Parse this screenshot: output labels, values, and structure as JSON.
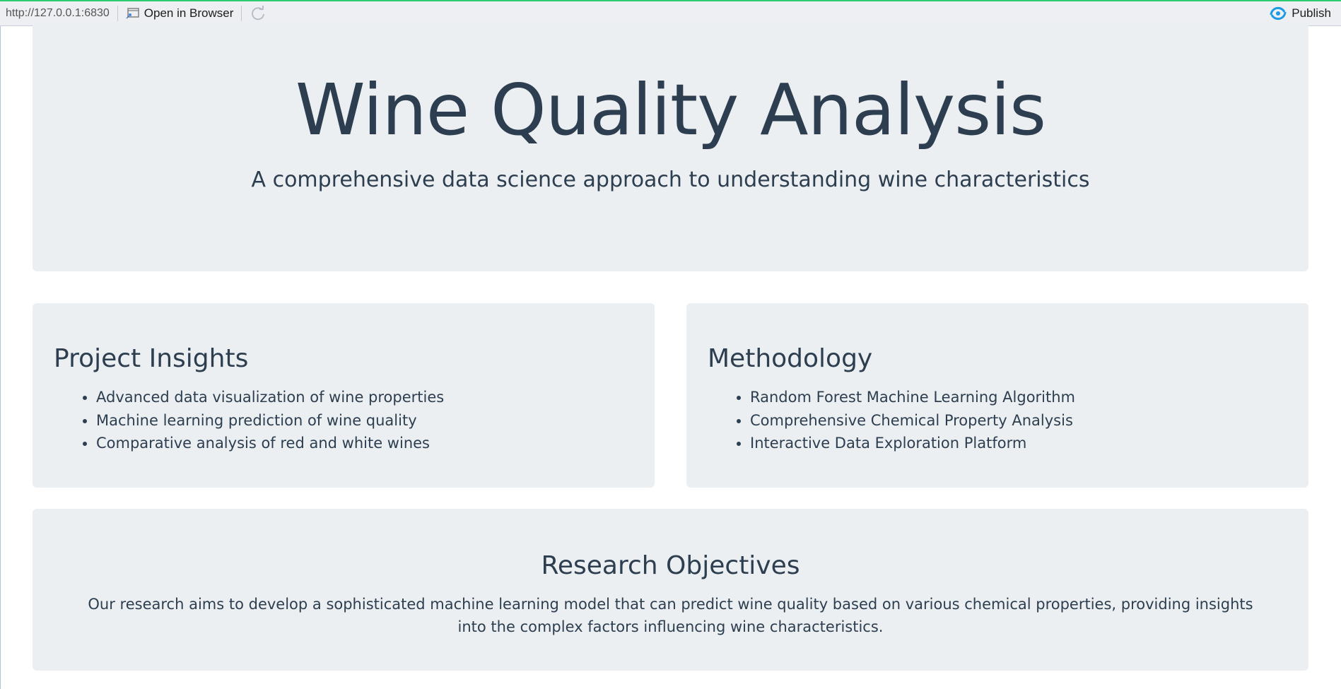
{
  "toolbar": {
    "url": "http://127.0.0.1:6830",
    "open_label": "Open in Browser",
    "publish_label": "Publish",
    "accent_color": "#1a9be6",
    "icons": [
      "open-in-browser-icon",
      "refresh-icon",
      "publish-icon"
    ]
  },
  "hero": {
    "title": "Wine Quality Analysis",
    "subtitle": "A comprehensive data science approach to understanding wine characteristics"
  },
  "insights": {
    "title": "Project Insights",
    "items": [
      "Advanced data visualization of wine properties",
      "Machine learning prediction of wine quality",
      "Comparative analysis of red and white wines"
    ]
  },
  "methodology": {
    "title": "Methodology",
    "items": [
      "Random Forest Machine Learning Algorithm",
      "Comprehensive Chemical Property Analysis",
      "Interactive Data Exploration Platform"
    ]
  },
  "objectives": {
    "title": "Research Objectives",
    "text": "Our research aims to develop a sophisticated machine learning model that can predict wine quality based on various chemical properties, providing insights into the complex factors influencing wine characteristics."
  },
  "colors": {
    "panel_background": "#eceff1",
    "text": "#2c3e50",
    "toolbar_top_border": "#2ecc71"
  }
}
